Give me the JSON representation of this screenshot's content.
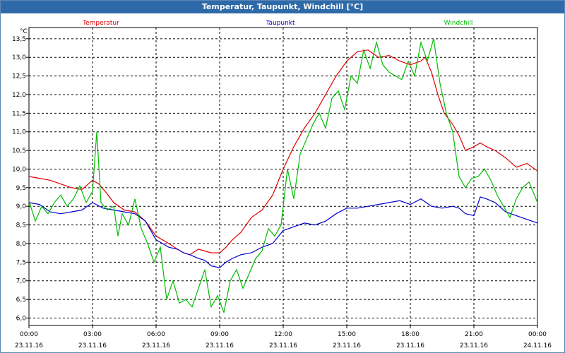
{
  "window": {
    "title": "Temperatur, Taupunkt, Windchill [°C]"
  },
  "chart_data": {
    "type": "line",
    "title": "Temperatur, Taupunkt, Windchill [°C]",
    "ylabel": "°C",
    "xlabel": "",
    "ylim": [
      5.8,
      13.8
    ],
    "yticks": [
      6.0,
      6.5,
      7.0,
      7.5,
      8.0,
      8.5,
      9.0,
      9.5,
      10.0,
      10.5,
      11.0,
      11.5,
      12.0,
      12.5,
      13.0,
      13.5
    ],
    "ytick_labels": [
      "6,0",
      "6,5",
      "7,0",
      "7,5",
      "8,0",
      "8,5",
      "9,0",
      "9,5",
      "10,0",
      "10,5",
      "11,0",
      "11,5",
      "12,0",
      "12,5",
      "13,0",
      "13,5"
    ],
    "xlim": [
      0,
      24
    ],
    "xticks": [
      0,
      3,
      6,
      9,
      12,
      15,
      18,
      21,
      24
    ],
    "xtick_times": [
      "00:00",
      "03:00",
      "06:00",
      "09:00",
      "12:00",
      "15:00",
      "18:00",
      "21:00",
      "00:00"
    ],
    "xtick_dates": [
      "23.11.16",
      "23.11.16",
      "23.11.16",
      "23.11.16",
      "23.11.16",
      "23.11.16",
      "23.11.16",
      "23.11.16",
      "24.11.16"
    ],
    "grid": true,
    "legend_placement": "top",
    "series": [
      {
        "name": "Temperatur",
        "color": "#dd0000",
        "x": [
          0,
          0.5,
          1,
          1.5,
          2,
          2.5,
          3,
          3.3,
          3.6,
          4,
          4.5,
          5,
          5.5,
          6,
          6.3,
          6.6,
          7,
          7.3,
          7.6,
          8,
          8.3,
          8.6,
          9,
          9.3,
          9.6,
          10,
          10.5,
          11,
          11.5,
          12,
          12.5,
          13,
          13.5,
          14,
          14.5,
          15,
          15.5,
          16,
          16.5,
          17,
          17.5,
          18,
          18.5,
          18.7,
          19,
          19.3,
          19.6,
          20,
          20.3,
          20.6,
          21,
          21.3,
          21.6,
          22,
          22.5,
          23,
          23.5,
          24
        ],
        "values": [
          9.8,
          9.75,
          9.7,
          9.6,
          9.5,
          9.45,
          9.7,
          9.6,
          9.4,
          9.1,
          8.9,
          8.85,
          8.6,
          8.2,
          8.1,
          8.0,
          7.85,
          7.75,
          7.7,
          7.85,
          7.8,
          7.75,
          7.75,
          7.9,
          8.1,
          8.3,
          8.7,
          8.9,
          9.3,
          10.0,
          10.6,
          11.1,
          11.5,
          12.0,
          12.5,
          12.9,
          13.15,
          13.2,
          13.0,
          13.05,
          12.9,
          12.8,
          12.9,
          13.0,
          12.6,
          12.0,
          11.5,
          11.2,
          10.9,
          10.5,
          10.6,
          10.7,
          10.6,
          10.5,
          10.3,
          10.05,
          10.15,
          9.95
        ]
      },
      {
        "name": "Taupunkt",
        "color": "#0000cc",
        "x": [
          0,
          0.5,
          1,
          1.5,
          2,
          2.5,
          3,
          3.5,
          4,
          4.5,
          5,
          5.5,
          6,
          6.3,
          6.6,
          7,
          7.3,
          7.6,
          8,
          8.3,
          8.6,
          9,
          9.3,
          9.6,
          10,
          10.5,
          11,
          11.5,
          12,
          12.5,
          13,
          13.5,
          14,
          14.5,
          15,
          15.5,
          16,
          16.5,
          17,
          17.5,
          18,
          18.5,
          19,
          19.5,
          20,
          20.3,
          20.6,
          21,
          21.3,
          21.6,
          22,
          22.5,
          23,
          23.5,
          24
        ],
        "values": [
          9.1,
          9.05,
          8.85,
          8.8,
          8.85,
          8.9,
          9.1,
          8.95,
          8.9,
          8.85,
          8.8,
          8.6,
          8.1,
          8.0,
          7.9,
          7.85,
          7.75,
          7.7,
          7.6,
          7.55,
          7.4,
          7.35,
          7.5,
          7.6,
          7.7,
          7.75,
          7.9,
          8.0,
          8.35,
          8.45,
          8.55,
          8.5,
          8.6,
          8.8,
          8.95,
          8.95,
          9.0,
          9.05,
          9.1,
          9.15,
          9.05,
          9.2,
          9.0,
          8.95,
          9.0,
          8.95,
          8.8,
          8.75,
          9.25,
          9.2,
          9.1,
          8.85,
          8.75,
          8.65,
          8.55
        ]
      },
      {
        "name": "Windchill",
        "color": "#00bb00",
        "x": [
          0,
          0.3,
          0.6,
          0.9,
          1.2,
          1.5,
          1.8,
          2.1,
          2.4,
          2.7,
          3,
          3.2,
          3.4,
          3.7,
          4,
          4.2,
          4.4,
          4.7,
          5,
          5.3,
          5.6,
          5.9,
          6.2,
          6.5,
          6.8,
          7.1,
          7.4,
          7.7,
          8,
          8.3,
          8.6,
          8.9,
          9.2,
          9.5,
          9.8,
          10.1,
          10.4,
          10.7,
          11,
          11.3,
          11.6,
          11.9,
          12.2,
          12.5,
          12.8,
          13.1,
          13.4,
          13.7,
          14,
          14.3,
          14.6,
          14.9,
          15.2,
          15.5,
          15.8,
          16.1,
          16.4,
          16.7,
          17,
          17.3,
          17.6,
          17.9,
          18.2,
          18.5,
          18.8,
          19.1,
          19.4,
          19.7,
          20,
          20.3,
          20.6,
          20.9,
          21.2,
          21.5,
          21.8,
          22.1,
          22.4,
          22.7,
          23,
          23.3,
          23.6,
          24
        ],
        "values": [
          9.15,
          8.6,
          9.0,
          8.8,
          9.1,
          9.3,
          9.0,
          9.2,
          9.55,
          9.1,
          9.4,
          11.0,
          9.1,
          8.9,
          9.0,
          8.2,
          8.8,
          8.5,
          9.2,
          8.4,
          8.0,
          7.5,
          7.9,
          6.5,
          7.0,
          6.4,
          6.5,
          6.3,
          6.8,
          7.3,
          6.3,
          6.6,
          6.15,
          7.0,
          7.3,
          6.8,
          7.2,
          7.6,
          7.8,
          8.4,
          8.2,
          8.5,
          10.0,
          9.2,
          10.4,
          10.8,
          11.2,
          11.5,
          11.1,
          11.9,
          12.1,
          11.6,
          12.5,
          12.3,
          13.2,
          12.7,
          13.4,
          12.8,
          12.6,
          12.5,
          12.4,
          12.9,
          12.5,
          13.4,
          12.9,
          13.5,
          12.3,
          11.5,
          11.0,
          9.8,
          9.5,
          9.75,
          9.8,
          10.0,
          9.7,
          9.3,
          9.0,
          8.7,
          9.2,
          9.5,
          9.65,
          9.1
        ]
      }
    ]
  }
}
